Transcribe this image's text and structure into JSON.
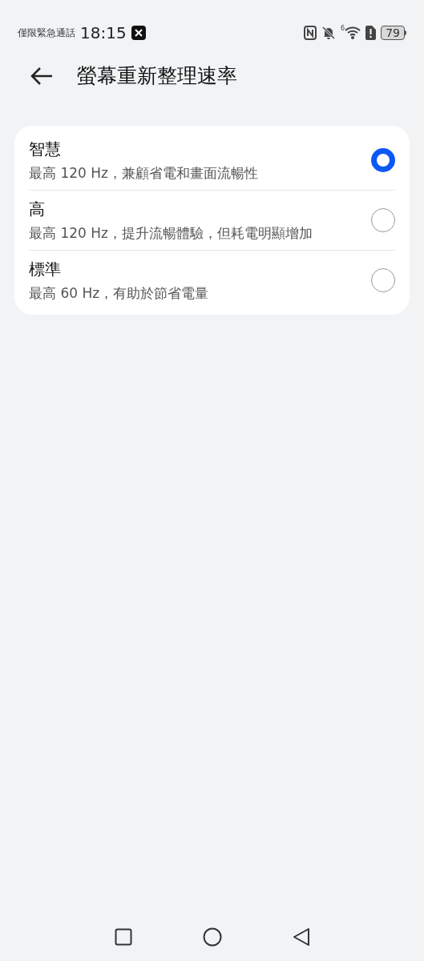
{
  "status_bar": {
    "carrier": "僅限緊急通話",
    "time": "18:15",
    "wifi_generation": "6",
    "battery": "79"
  },
  "header": {
    "title": "螢幕重新整理速率"
  },
  "options": [
    {
      "title": "智慧",
      "description": "最高 120 Hz，兼顧省電和畫面流暢性",
      "selected": true
    },
    {
      "title": "高",
      "description": "最高 120 Hz，提升流暢體驗，但耗電明顯增加",
      "selected": false
    },
    {
      "title": "標準",
      "description": "最高 60 Hz，有助於節省電量",
      "selected": false
    }
  ]
}
